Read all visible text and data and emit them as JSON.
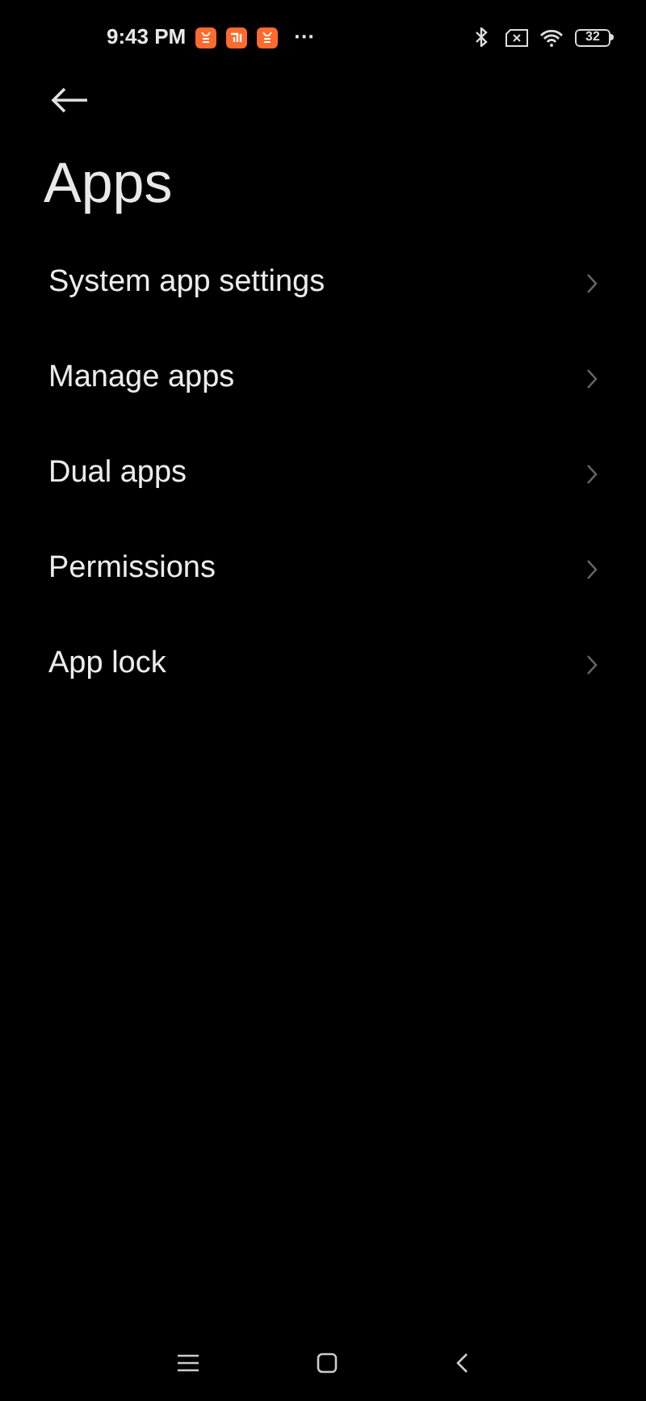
{
  "status_bar": {
    "time": "9:43 PM",
    "notification_icons": [
      {
        "kind": "app"
      },
      {
        "kind": "mi"
      },
      {
        "kind": "app"
      }
    ],
    "more": "···",
    "battery": "32"
  },
  "title": "Apps",
  "items": [
    {
      "label": "System app settings"
    },
    {
      "label": "Manage apps"
    },
    {
      "label": "Dual apps"
    },
    {
      "label": "Permissions"
    },
    {
      "label": "App lock"
    }
  ]
}
